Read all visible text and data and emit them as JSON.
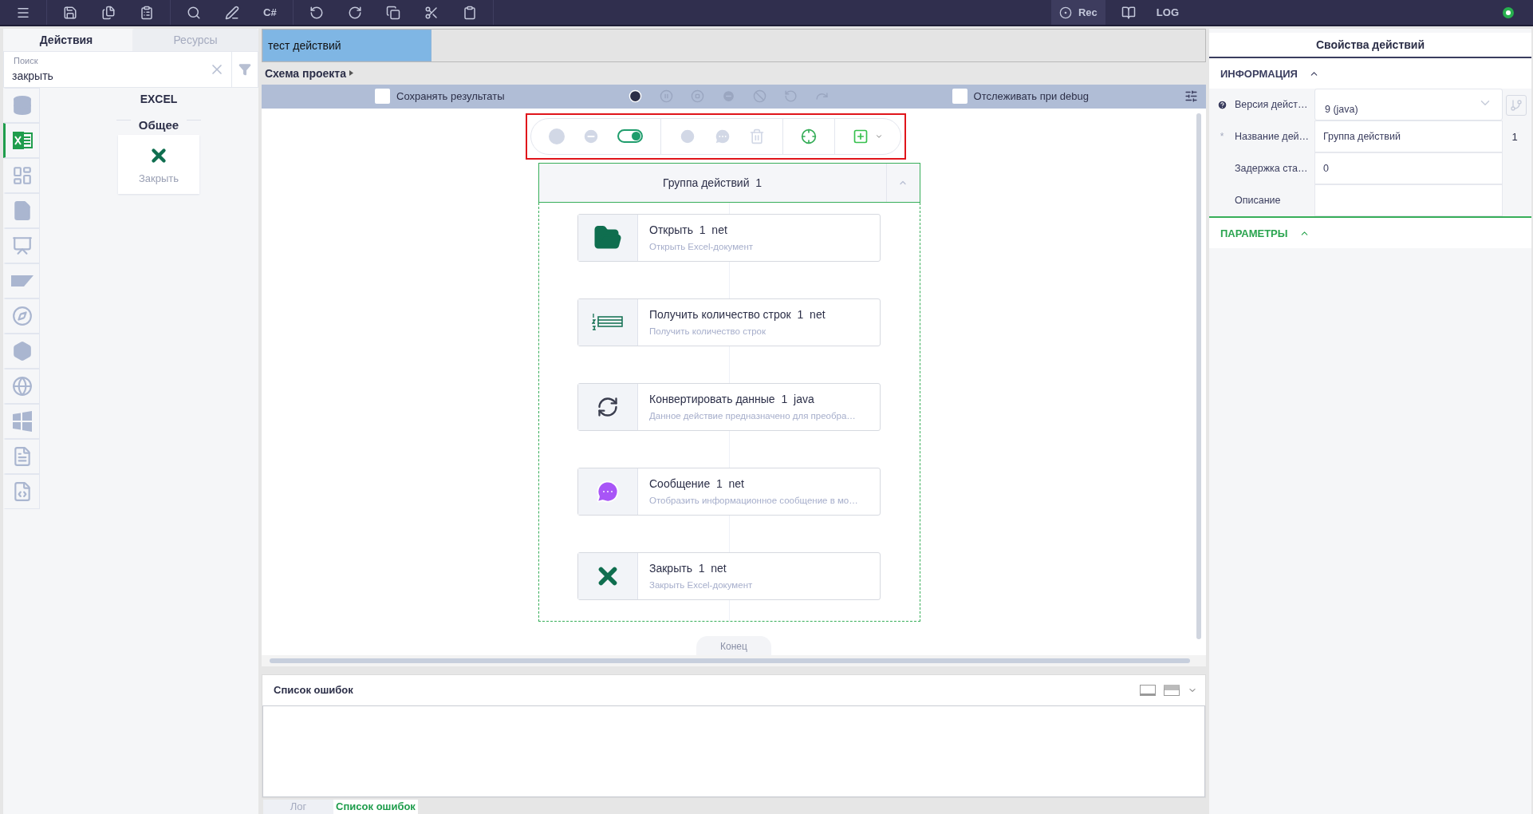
{
  "topbar": {
    "csharp": "C#",
    "rec": "Rec",
    "log": "LOG",
    "connected": true
  },
  "left": {
    "tabs": [
      {
        "label": "Действия",
        "selected": true
      },
      {
        "label": "Ресурсы",
        "selected": false
      }
    ],
    "search": {
      "placeholder": "Поиск",
      "value": "закрыть"
    },
    "categories": [
      {
        "kind": "database",
        "selected": false
      },
      {
        "kind": "excel",
        "selected": true
      },
      {
        "kind": "table",
        "selected": false
      },
      {
        "kind": "file",
        "selected": false
      },
      {
        "kind": "powerpoint",
        "selected": false
      },
      {
        "kind": "sap",
        "selected": false
      },
      {
        "kind": "browser",
        "selected": false
      },
      {
        "kind": "app",
        "selected": false
      },
      {
        "kind": "web",
        "selected": false
      },
      {
        "kind": "windows",
        "selected": false
      },
      {
        "kind": "word",
        "selected": false
      },
      {
        "kind": "xml",
        "selected": false
      }
    ],
    "section": "EXCEL",
    "group": "Общее",
    "items": [
      {
        "label": "Закрыть"
      }
    ]
  },
  "doc_tabs": [
    {
      "label": "тест действий",
      "selected": true
    }
  ],
  "breadcrumb": "Схема проекта",
  "runbar": {
    "save_results": {
      "label": "Сохранять результаты",
      "checked": false
    },
    "debug_watch": {
      "label": "Отслеживать при debug",
      "checked": false
    }
  },
  "floating_toolbar": {
    "highlighted": true,
    "enabled_toggle_on": true
  },
  "group": {
    "title": "Группа действий",
    "number": "1",
    "expanded": true,
    "actions": [
      {
        "kind": "open",
        "title": "Открыть",
        "number": "1",
        "platform": "net",
        "description": "Открыть Excel-документ"
      },
      {
        "kind": "rows",
        "title": "Получить количество строк",
        "number": "1",
        "platform": "net",
        "description": "Получить количество строк"
      },
      {
        "kind": "convert",
        "title": "Конвертировать данные",
        "number": "1",
        "platform": "java",
        "description": "Данное действие предназначено для преобра…"
      },
      {
        "kind": "message",
        "title": "Сообщение",
        "number": "1",
        "platform": "net",
        "description": "Отобразить информационное сообщение в мо…"
      },
      {
        "kind": "close",
        "title": "Закрыть",
        "number": "1",
        "platform": "net",
        "description": "Закрыть Excel-документ"
      }
    ]
  },
  "end_label": "Конец",
  "errors_panel": {
    "title": "Список ошибок"
  },
  "bottom_tabs": [
    {
      "label": "Лог",
      "selected": false
    },
    {
      "label": "Список ошибок",
      "selected": true
    }
  ],
  "properties": {
    "title": "Свойства действий",
    "sections": [
      {
        "title": "ИНФОРМАЦИЯ",
        "expanded": true,
        "rows": [
          {
            "kind": "select",
            "help": true,
            "label": "Версия дейст…",
            "value": "9 (java)"
          },
          {
            "kind": "text",
            "help": false,
            "mark": "*",
            "label": "Название дей…",
            "value": "Группа действий",
            "suffix": "1"
          },
          {
            "kind": "text",
            "help": false,
            "label": "Задержка ста…",
            "value": "0"
          },
          {
            "kind": "text",
            "help": false,
            "label": "Описание"
          }
        ]
      },
      {
        "title": "ПАРАМЕТРЫ",
        "expanded": true
      }
    ]
  }
}
